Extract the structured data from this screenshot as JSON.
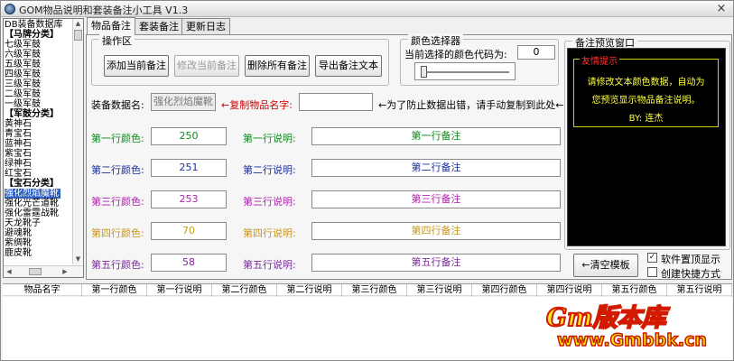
{
  "window": {
    "title": "GOM物品说明和套装备注小工具 V1.3",
    "close_glyph": "×"
  },
  "left_list": {
    "header": "DB装备数据库",
    "rows": [
      {
        "text": "【马牌分类】",
        "type": "cat"
      },
      {
        "text": "七级军鼓",
        "type": "item"
      },
      {
        "text": "六级军鼓",
        "type": "item"
      },
      {
        "text": "五级军鼓",
        "type": "item"
      },
      {
        "text": "四级军鼓",
        "type": "item"
      },
      {
        "text": "三级军鼓",
        "type": "item"
      },
      {
        "text": "二级军鼓",
        "type": "item"
      },
      {
        "text": "一级军鼓",
        "type": "item"
      },
      {
        "text": "【军鼓分类】",
        "type": "cat"
      },
      {
        "text": "黄神石",
        "type": "item"
      },
      {
        "text": "青宝石",
        "type": "item"
      },
      {
        "text": "蓝神石",
        "type": "item"
      },
      {
        "text": "紫宝石",
        "type": "item"
      },
      {
        "text": "绿神石",
        "type": "item"
      },
      {
        "text": "红宝石",
        "type": "item"
      },
      {
        "text": "【宝石分类】",
        "type": "cat"
      },
      {
        "text": "强化烈焰魔靴",
        "type": "sel"
      },
      {
        "text": "强化光芒道靴",
        "type": "item"
      },
      {
        "text": "强化雷霆战靴",
        "type": "item"
      },
      {
        "text": "天龙靴子",
        "type": "item"
      },
      {
        "text": "避魂靴",
        "type": "item"
      },
      {
        "text": "紫绸靴",
        "type": "item"
      },
      {
        "text": "鹿皮靴",
        "type": "item"
      }
    ]
  },
  "tabs": [
    {
      "label": "物品备注",
      "active": true
    },
    {
      "label": "套装备注",
      "active": false
    },
    {
      "label": "更新日志",
      "active": false
    }
  ],
  "ops": {
    "title": "操作区",
    "add": "添加当前备注",
    "modify": "修改当前备注",
    "delete_all": "删除所有备注",
    "export": "导出备注文本"
  },
  "color_picker": {
    "title": "颜色选择器",
    "current_label": "当前选择的颜色代码为:",
    "current_value": "0",
    "level": 0
  },
  "item_name": {
    "label": "装备数据名:",
    "value": "强化烈焰魔靴",
    "copy_hint": "←复制物品名字:",
    "copy_value": "",
    "warning": "←为了防止数据出错，请手动复制到此处←"
  },
  "lines": [
    {
      "color_label": "第一行颜色:",
      "color_value": "250",
      "desc_label": "第一行说明:",
      "desc_value": "第一行备注",
      "color": "#0e8a1e"
    },
    {
      "color_label": "第二行颜色:",
      "color_value": "251",
      "desc_label": "第二行说明:",
      "desc_value": "第二行备注",
      "color": "#1a2f9a"
    },
    {
      "color_label": "第三行颜色:",
      "color_value": "253",
      "desc_label": "第三行说明:",
      "desc_value": "第三行备注",
      "color": "#b020b0"
    },
    {
      "color_label": "第四行颜色:",
      "color_value": "70",
      "desc_label": "第四行说明:",
      "desc_value": "第四行备注",
      "color": "#c8961e"
    },
    {
      "color_label": "第五行颜色:",
      "color_value": "58",
      "desc_label": "第五行说明:",
      "desc_value": "第五行备注",
      "color": "#7a2a9a"
    }
  ],
  "preview": {
    "title": "备注预览窗口",
    "box_title": "友情提示",
    "line1": "请修改文本颜色数据，自动为",
    "line2": "您预览显示物品备注说明。",
    "line3": "BY:  连杰"
  },
  "clear_button": "←清空模板",
  "checkboxes": [
    {
      "label": "软件置顶显示",
      "checked": true
    },
    {
      "label": "创建快捷方式",
      "checked": false
    }
  ],
  "table_headers": [
    "物品名字",
    "第一行颜色",
    "第一行说明",
    "第二行颜色",
    "第二行说明",
    "第三行颜色",
    "第三行说明",
    "第四行颜色",
    "第四行说明",
    "第五行颜色",
    "第五行说明"
  ],
  "watermark": {
    "logo": "Gm版本库",
    "url": "www.Gmbbk.cn"
  },
  "colors": {
    "preview_bg": "#000000",
    "preview_text": "#ffff40",
    "preview_title": "#ff3030",
    "copy_hint": "#cc0000",
    "selection": "#3060c0"
  }
}
